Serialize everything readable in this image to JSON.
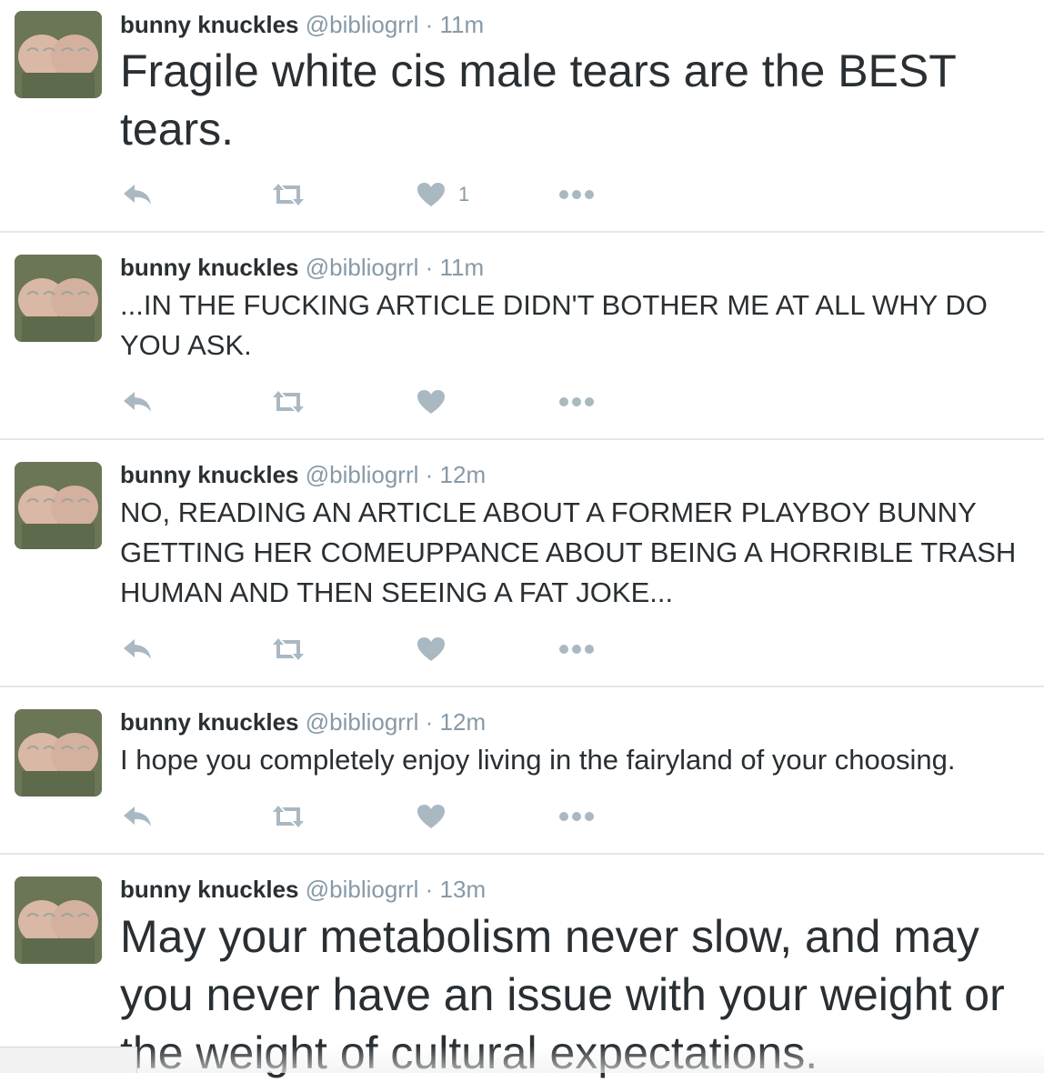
{
  "tweets": [
    {
      "name": "bunny knuckles",
      "handle": "@bibliogrrl",
      "separator": "·",
      "time": "11m",
      "text": "Fragile white cis male tears are the BEST tears.",
      "size": "large",
      "likes": "1"
    },
    {
      "name": "bunny knuckles",
      "handle": "@bibliogrrl",
      "separator": "·",
      "time": "11m",
      "text": "...IN THE FUCKING ARTICLE DIDN'T BOTHER ME AT ALL WHY DO YOU ASK.",
      "size": "small",
      "likes": ""
    },
    {
      "name": "bunny knuckles",
      "handle": "@bibliogrrl",
      "separator": "·",
      "time": "12m",
      "text": "NO, READING AN ARTICLE ABOUT A FORMER PLAYBOY BUNNY GETTING HER COMEUPPANCE ABOUT BEING A HORRIBLE TRASH HUMAN AND THEN SEEING A FAT JOKE...",
      "size": "small",
      "likes": ""
    },
    {
      "name": "bunny knuckles",
      "handle": "@bibliogrrl",
      "separator": "·",
      "time": "12m",
      "text": "I hope you completely enjoy living in the fairyland of your choosing.",
      "size": "small",
      "likes": ""
    },
    {
      "name": "bunny knuckles",
      "handle": "@bibliogrrl",
      "separator": "·",
      "time": "13m",
      "text": "May your metabolism never slow, and may you never have an issue with your weight or the weight of cultural expectations.",
      "size": "large",
      "likes": ""
    }
  ],
  "icons": {
    "reply": "reply-icon",
    "retweet": "retweet-icon",
    "like": "heart-icon",
    "more": "more-icon"
  },
  "colors": {
    "text": "#292f33",
    "meta": "#8899a6",
    "action": "#aab8c2",
    "divider": "#e1e8ed"
  }
}
